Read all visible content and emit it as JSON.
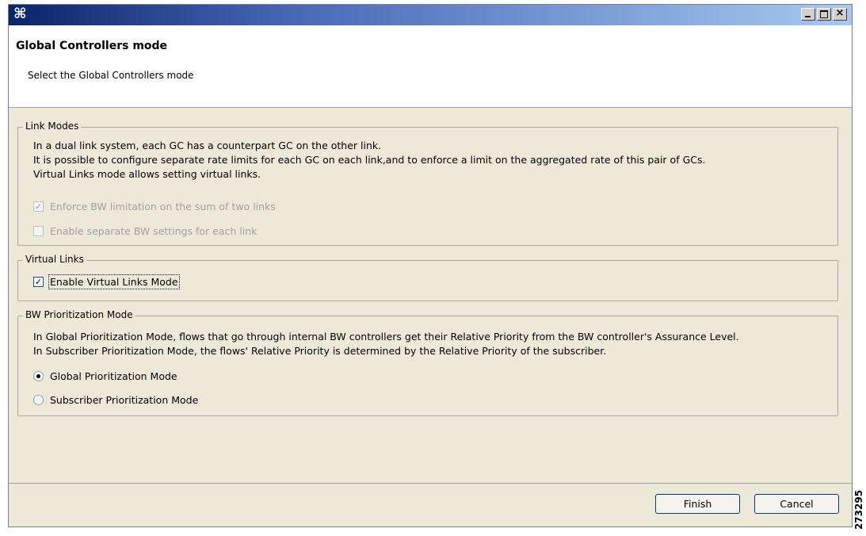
{
  "window": {
    "title_icon": "app-logo-icon"
  },
  "header": {
    "title": "Global Controllers mode",
    "subtitle": "Select the Global Controllers mode"
  },
  "link_modes": {
    "legend": "Link Modes",
    "description": [
      "In a dual link system, each GC has a counterpart GC on the other link.",
      "It is possible to configure separate rate limits for each GC on each link,and to enforce a limit on the aggregated rate of this pair of GCs.",
      "Virtual Links mode allows setting virtual links."
    ],
    "enforce_label": "Enforce BW limitation on the sum of two links",
    "enforce_checked": true,
    "separate_label": "Enable separate BW settings for each link",
    "separate_checked": false
  },
  "virtual_links": {
    "legend": "Virtual Links",
    "enable_label": "Enable Virtual Links Mode",
    "enable_checked": true
  },
  "bw_prioritization": {
    "legend": "BW Prioritization Mode",
    "description": [
      "In Global Prioritization Mode, flows that go through internal BW controllers get their Relative Priority from the BW controller's Assurance Level.",
      "In Subscriber Prioritization Mode, the flows' Relative Priority is determined by the Relative Priority of the subscriber."
    ],
    "global_label": "Global Prioritization Mode",
    "subscriber_label": "Subscriber Prioritization Mode",
    "selected": "Global Prioritization Mode"
  },
  "buttons": {
    "finish": "Finish",
    "cancel": "Cancel"
  },
  "figure_id": "273295"
}
